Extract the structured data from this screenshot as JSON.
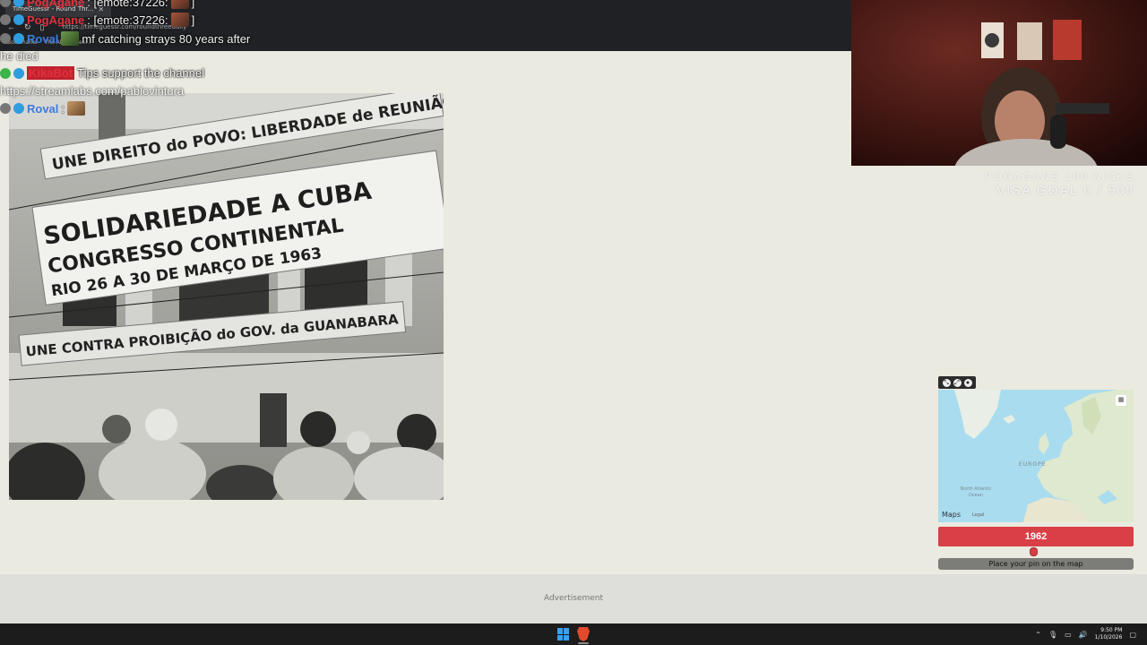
{
  "browser": {
    "tab_title": "TimeGuessr - Round Thr...",
    "url": "https://timeguessr.com/roundthreedaily",
    "bookmarks": [
      "Bookmarks",
      "The Ab...",
      "Ree..."
    ]
  },
  "chat": {
    "lines": [
      {
        "user": "PogAgane",
        "user_color": "#e0313d",
        "text": ": [emote:37226:"
      },
      {
        "user": "PogAgane",
        "user_color": "#e0313d",
        "text": ": [emote:37226:"
      },
      {
        "user": "Roval",
        "user_color": "#3d7be0",
        "text": "mf catching strays 80 years after"
      }
    ],
    "wrap_text": "he died",
    "bot_user": "KikaBot",
    "bot_text": "Tips support the channel",
    "link_text": "https://streamlabs.com/pablovintura",
    "last_user": "Roval",
    "last_user_color": "#3d7be0"
  },
  "photo": {
    "banner_top": "UNE DIREITO do POVO: LIBERDADE de REUNIÃO",
    "banner_main_1": "SOLIDARIEDADE A CUBA",
    "banner_main_2": "CONGRESSO CONTINENTAL",
    "banner_main_3": "RIO 26 A 30 DE MARÇO DE 1963",
    "banner_bottom": "UNE CONTRA PROIBIÇÃO do GOV. da GUANABARA"
  },
  "overlay": {
    "goal_line1": "POGAGANE 100 KICKS",
    "goal_line2": "VISA GOAL 0 / 500"
  },
  "map": {
    "label_europe": "EUROPE",
    "label_ocean": "North Atlantic Ocean",
    "brand": "Maps",
    "legal": "Legal"
  },
  "year_selector": {
    "year": "1962",
    "slider_fraction": 0.49,
    "accent": "#d93f46"
  },
  "pin_button": "Place your pin on the map",
  "ad_label": "Advertisement",
  "taskbar": {
    "time": "9:50 PM",
    "date": "1/10/2026"
  }
}
